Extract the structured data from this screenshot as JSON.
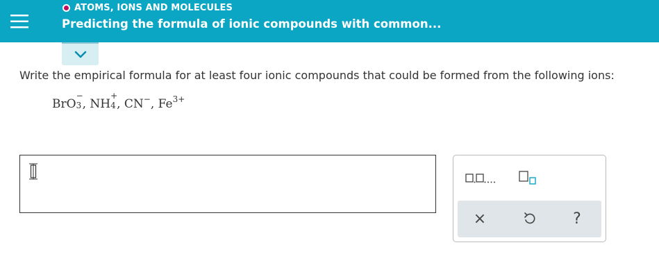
{
  "header": {
    "topic": "ATOMS, IONS AND MOLECULES",
    "title": "Predicting the formula of ionic compounds with common..."
  },
  "question": {
    "prompt": "Write the empirical formula for at least four ionic compounds that could be formed from the following ions:",
    "ions": [
      {
        "base": "BrO",
        "sub": "3",
        "charge": "−"
      },
      {
        "base": "NH",
        "sub": "4",
        "charge": "+"
      },
      {
        "base": "CN",
        "sub": "",
        "charge": "−"
      },
      {
        "base": "Fe",
        "sub": "",
        "charge": "3+"
      }
    ],
    "separator": ", "
  },
  "answer": {
    "value": ""
  },
  "palette": {
    "list_template_label": "□,□,...",
    "subscript_template_label": "subscript",
    "clear_label": "×",
    "undo_label": "undo",
    "help_label": "?"
  },
  "colors": {
    "header_bg": "#0aa6c4",
    "topic_dot": "#c0105b",
    "accent": "#0aa6c4"
  }
}
